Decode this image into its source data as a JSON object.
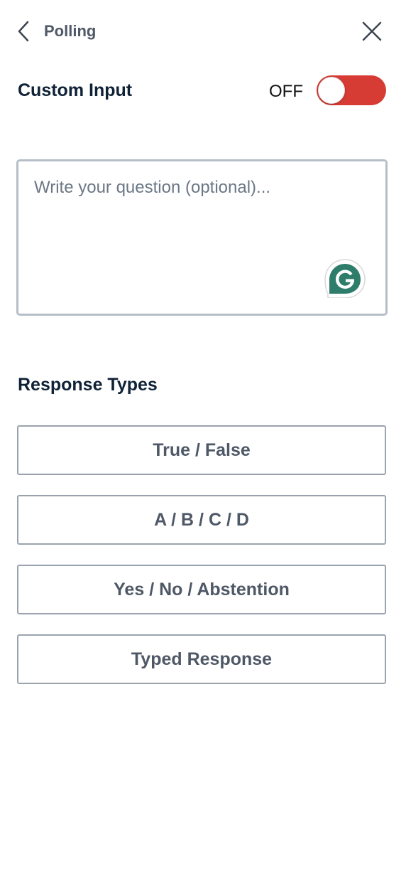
{
  "header": {
    "title": "Polling",
    "back_icon": "chevron-left-icon",
    "close_icon": "close-icon"
  },
  "custom_input": {
    "label": "Custom Input",
    "toggle_state": "OFF",
    "toggle_color": "#d63b34"
  },
  "question": {
    "placeholder": "Write your question (optional)...",
    "value": "",
    "grammarly_icon": "grammarly-icon",
    "grammarly_color": "#2e7d6b"
  },
  "response_types": {
    "title": "Response Types",
    "options": [
      {
        "label": "True / False"
      },
      {
        "label": "A / B / C / D"
      },
      {
        "label": "Yes / No / Abstention"
      },
      {
        "label": "Typed Response"
      }
    ]
  }
}
